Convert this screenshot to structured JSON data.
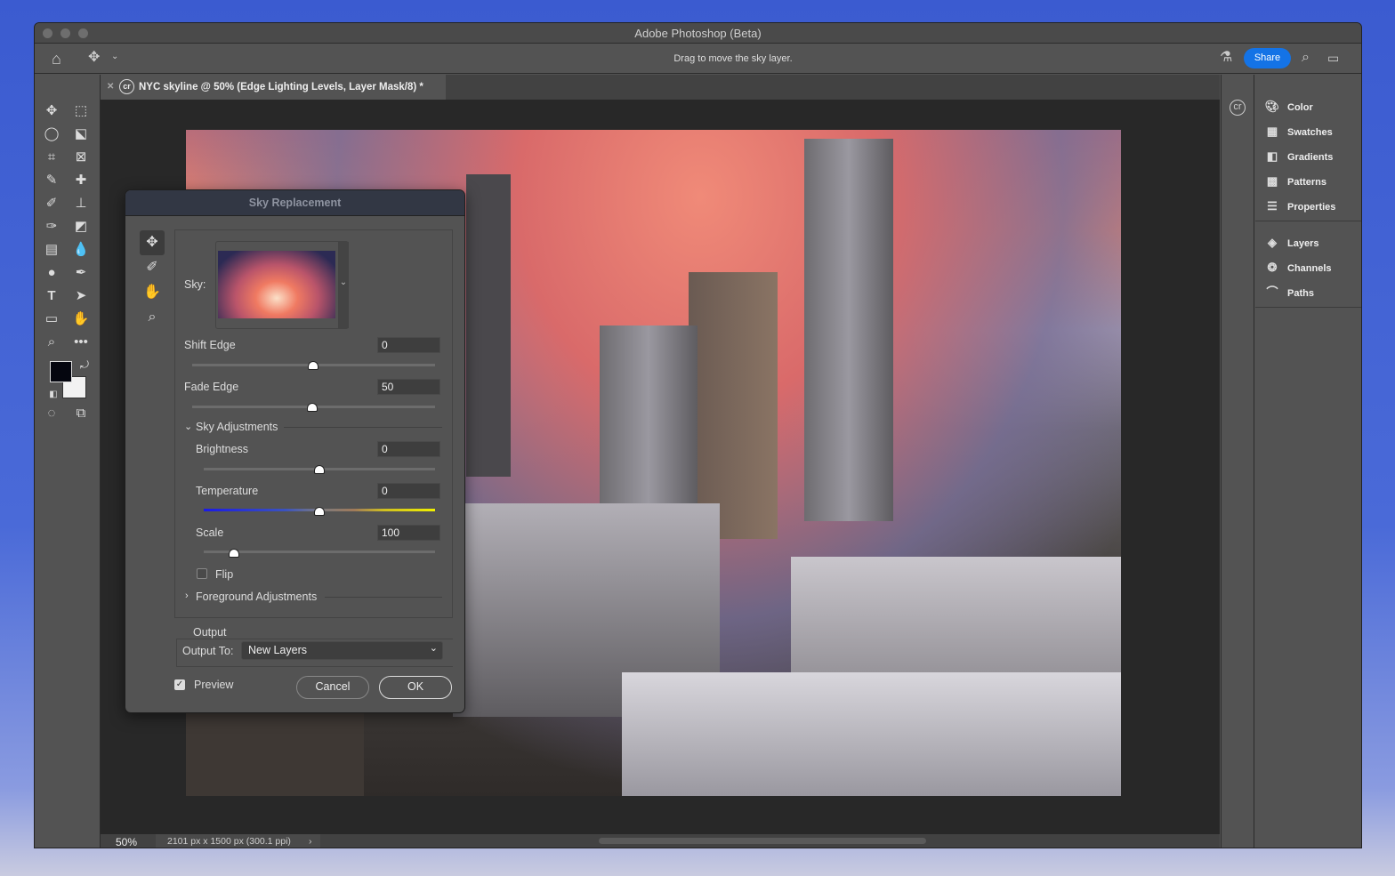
{
  "window": {
    "title": "Adobe Photoshop (Beta)"
  },
  "options_bar": {
    "hint": "Drag to move the sky layer.",
    "share_label": "Share"
  },
  "document_tab": {
    "title": "NYC skyline @ 50% (Edge Lighting Levels, Layer Mask/8) *",
    "cr_badge": "cr"
  },
  "status": {
    "zoom": "50%",
    "doc_info": "2101 px x 1500 px (300.1 ppi)"
  },
  "panels": {
    "group1": [
      {
        "label": "Color",
        "icon": "palette-icon"
      },
      {
        "label": "Swatches",
        "icon": "grid-icon"
      },
      {
        "label": "Gradients",
        "icon": "gradient-icon"
      },
      {
        "label": "Patterns",
        "icon": "pattern-icon"
      },
      {
        "label": "Properties",
        "icon": "sliders-icon"
      }
    ],
    "group2": [
      {
        "label": "Layers",
        "icon": "layers-icon"
      },
      {
        "label": "Channels",
        "icon": "channels-icon"
      },
      {
        "label": "Paths",
        "icon": "paths-icon"
      }
    ]
  },
  "dialog": {
    "title": "Sky Replacement",
    "sky_label": "Sky:",
    "shift_edge": {
      "label": "Shift Edge",
      "value": "0"
    },
    "fade_edge": {
      "label": "Fade Edge",
      "value": "50"
    },
    "sky_adjustments": {
      "label": "Sky Adjustments",
      "brightness": {
        "label": "Brightness",
        "value": "0"
      },
      "temperature": {
        "label": "Temperature",
        "value": "0"
      },
      "scale": {
        "label": "Scale",
        "value": "100"
      },
      "flip": {
        "label": "Flip",
        "checked": false
      }
    },
    "foreground_adjustments": {
      "label": "Foreground Adjustments"
    },
    "output": {
      "section": "Output",
      "label": "Output To:",
      "value": "New Layers"
    },
    "preview": {
      "label": "Preview",
      "checked": true
    },
    "cancel_label": "Cancel",
    "ok_label": "OK"
  },
  "colors": {
    "accent": "#1473e6",
    "foreground": "#05060f",
    "background": "#f2f2f2"
  }
}
